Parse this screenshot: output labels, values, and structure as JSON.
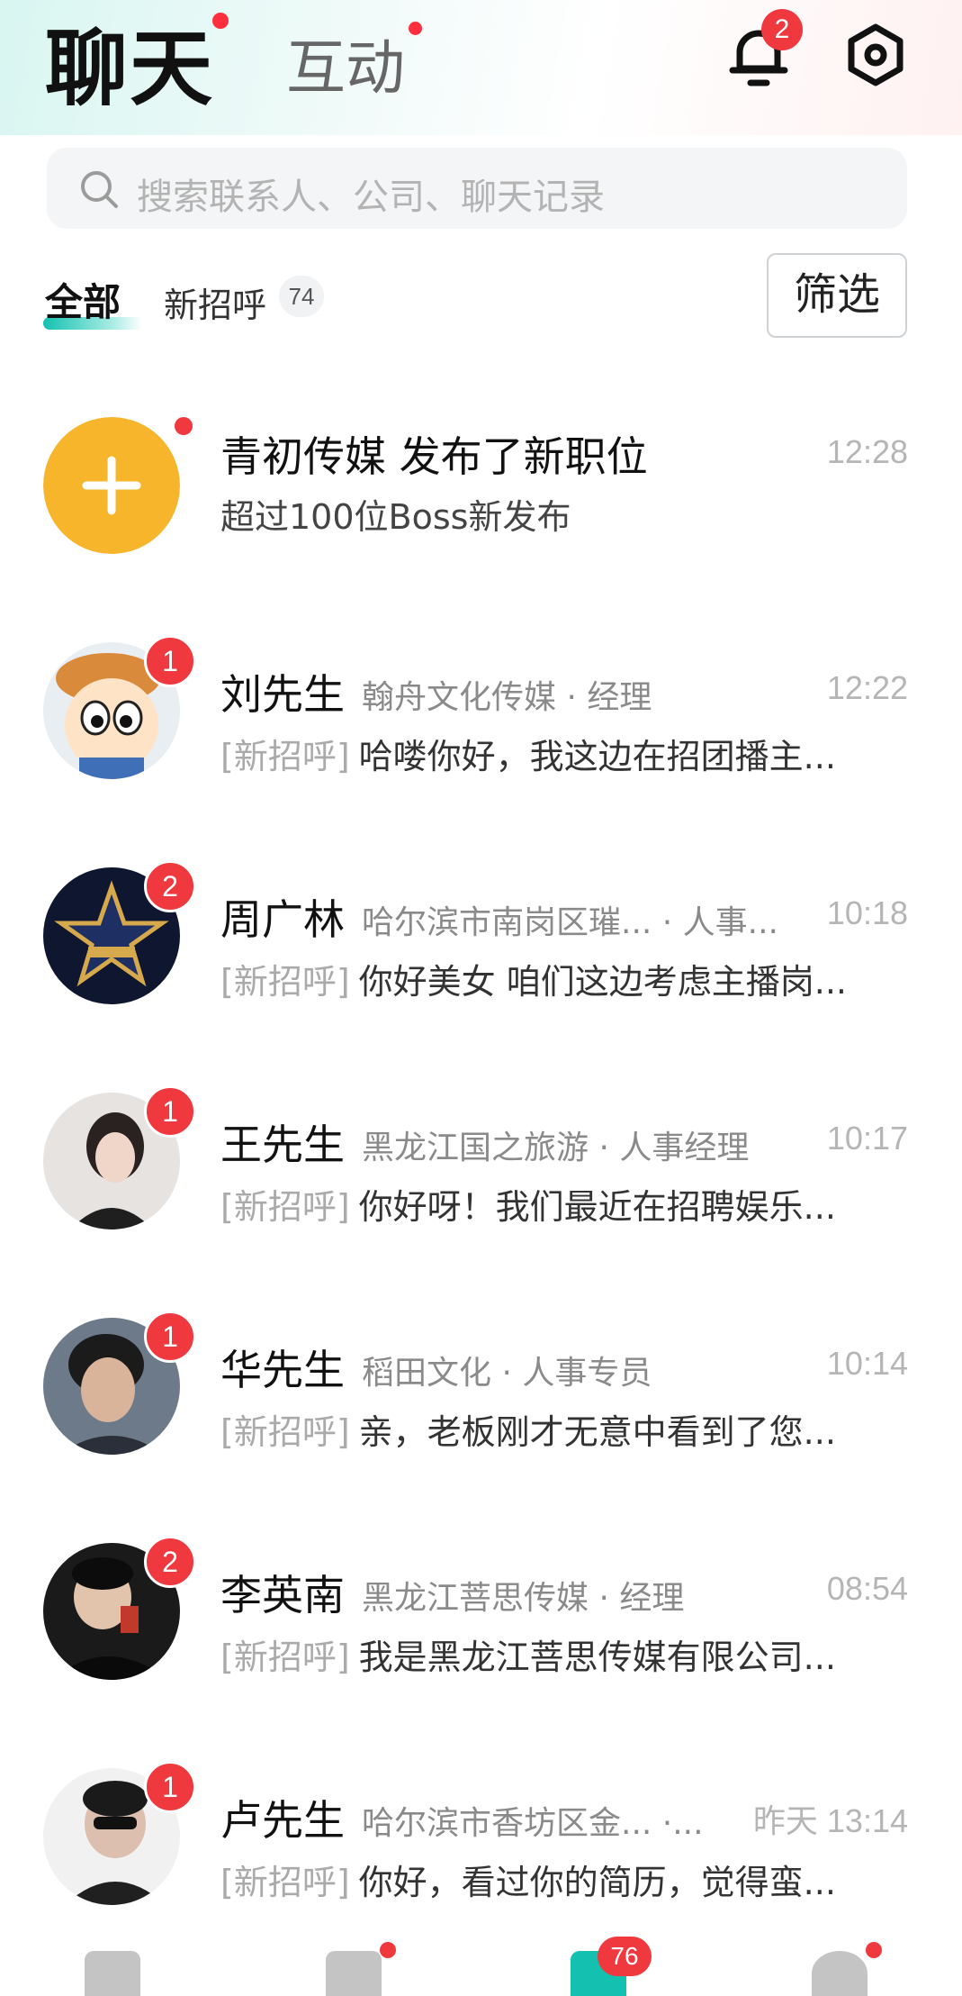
{
  "header": {
    "tab_chat": "聊天",
    "tab_interact": "互动",
    "notification_count": "2"
  },
  "search": {
    "placeholder": "搜索联系人、公司、聊天记录"
  },
  "filters": {
    "all": "全部",
    "new_greeting": "新招呼",
    "new_greeting_count": "74",
    "filter_button": "筛选"
  },
  "system_item": {
    "title": "青初传媒 发布了新职位",
    "subtitle": "超过100位Boss新发布",
    "time": "12:28"
  },
  "conversations": [
    {
      "name": "刘先生",
      "company": "翰舟文化传媒 · 经理",
      "time": "12:22",
      "tag": "[新招呼]",
      "message": "哈喽你好，我这边在招团播主...",
      "unread": "1"
    },
    {
      "name": "周广林",
      "company": "哈尔滨市南岗区璀... · 人事...",
      "time": "10:18",
      "tag": "[新招呼]",
      "message": "你好美女 咱们这边考虑主播岗...",
      "unread": "2"
    },
    {
      "name": "王先生",
      "company": "黑龙江国之旅游 · 人事经理",
      "time": "10:17",
      "tag": "[新招呼]",
      "message": "你好呀！我们最近在招聘娱乐...",
      "unread": "1"
    },
    {
      "name": "华先生",
      "company": "稻田文化 · 人事专员",
      "time": "10:14",
      "tag": "[新招呼]",
      "message": "亲，老板刚才无意中看到了您...",
      "unread": "1"
    },
    {
      "name": "李英南",
      "company": "黑龙江菩思传媒 · 经理",
      "time": "08:54",
      "tag": "[新招呼]",
      "message": "我是黑龙江菩思传媒有限公司...",
      "unread": "2"
    },
    {
      "name": "卢先生",
      "company": "哈尔滨市香坊区金... ·...",
      "time": "昨天 13:14",
      "tag": "[新招呼]",
      "message": "你好，看过你的简历，觉得蛮...",
      "unread": "1"
    }
  ],
  "bottom_nav": {
    "messages_badge": "76"
  },
  "colors": {
    "accent": "#14c1b1",
    "badge": "#f0383f",
    "system_avatar": "#f7b52c"
  }
}
